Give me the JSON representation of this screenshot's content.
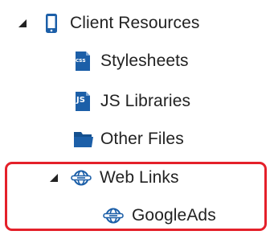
{
  "tree": {
    "root": {
      "label": "Client Resources",
      "icon": "tablet-device-icon",
      "expanded": true
    },
    "children": [
      {
        "label": "Stylesheets",
        "icon": "css-file-icon",
        "badge": "css"
      },
      {
        "label": "JS Libraries",
        "icon": "js-file-icon",
        "badge": "JS"
      },
      {
        "label": "Other Files",
        "icon": "folder-icon"
      },
      {
        "label": "Web Links",
        "icon": "globe-link-icon",
        "expanded": true,
        "highlighted": true,
        "children": [
          {
            "label": "GoogleAds",
            "icon": "globe-link-icon"
          }
        ]
      }
    ]
  },
  "colors": {
    "icon_blue": "#1c5fa8",
    "highlight_red": "#e4202a",
    "text": "#222222"
  }
}
